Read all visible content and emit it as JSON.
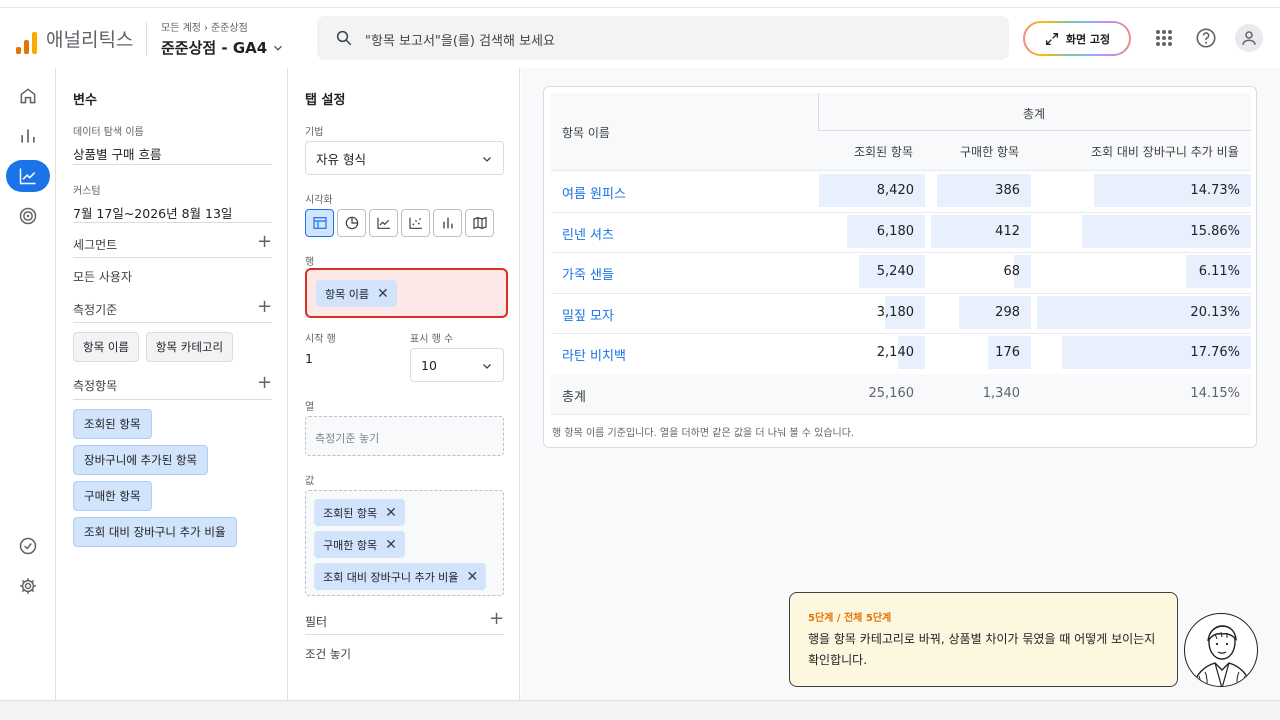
{
  "header": {
    "brand": "애널리틱스",
    "breadcrumb": [
      "모든 계정",
      "준준상점"
    ],
    "property": "준준상점 - GA4",
    "search_placeholder": "\"항목 보고서\"을(를) 검색해 보세요",
    "pin_label": "화면 고정",
    "logo_colors": [
      "#f9ab00",
      "#e37400",
      "#e37400"
    ]
  },
  "variables": {
    "title": "변수",
    "exploration_label": "데이터 탐색 이름",
    "exploration_name": "상품별 구매 흐름",
    "custom_label": "커스텀",
    "date_range": "7월 17일~2026년 8월 13일",
    "segments_label": "세그먼트",
    "segment_value": "모든 사용자",
    "dimensions_label": "측정기준",
    "dimensions": [
      "항목 이름",
      "항목 카테고리"
    ],
    "metrics_label": "측정항목",
    "metrics": [
      "조회된 항목",
      "장바구니에 추가된 항목",
      "구매한 항목",
      "조회 대비 장바구니 추가 비율"
    ]
  },
  "tab_settings": {
    "title": "탭 설정",
    "technique_label": "기법",
    "technique_value": "자유 형식",
    "visualization_label": "시각화",
    "rows_label": "행",
    "row_chip": "항목 이름",
    "start_row_label": "시작 행",
    "start_row_value": "1",
    "show_rows_label": "표시 행 수",
    "show_rows_value": "10",
    "columns_label": "열",
    "columns_placeholder": "측정기준 놓기",
    "values_label": "값",
    "values_chips": [
      "조회된 항목",
      "구매한 항목",
      "조회 대비 장바구니 추가 비율"
    ],
    "filters_label": "필터",
    "filters_placeholder": "조건 놓기"
  },
  "table": {
    "group_header": "총계",
    "row_header": "항목 이름",
    "columns": [
      "조회된 항목",
      "구매한 항목",
      "조회 대비 장바구니 추가 비율"
    ],
    "rows": [
      {
        "name": "여름 원피스",
        "views": "8,420",
        "purchased": "386",
        "rate": "14.73%"
      },
      {
        "name": "린넨 셔츠",
        "views": "6,180",
        "purchased": "412",
        "rate": "15.86%"
      },
      {
        "name": "가죽 샌들",
        "views": "5,240",
        "purchased": "68",
        "rate": "6.11%"
      },
      {
        "name": "밀짚 모자",
        "views": "3,180",
        "purchased": "298",
        "rate": "20.13%"
      },
      {
        "name": "라탄 비치백",
        "views": "2,140",
        "purchased": "176",
        "rate": "17.76%"
      }
    ],
    "total": {
      "name": "총계",
      "views": "25,160",
      "purchased": "1,340",
      "rate": "14.15%"
    },
    "note": "행 항목 이름 기준입니다. 열을 더하면 같은 값을 더 나눠 볼 수 있습니다."
  },
  "coach": {
    "step": "5단계 / 전체 5단계",
    "message": "행을 항목 카테고리로 바꿔, 상품별 차이가 묶였을 때 어떻게 보이는지 확인합니다."
  }
}
